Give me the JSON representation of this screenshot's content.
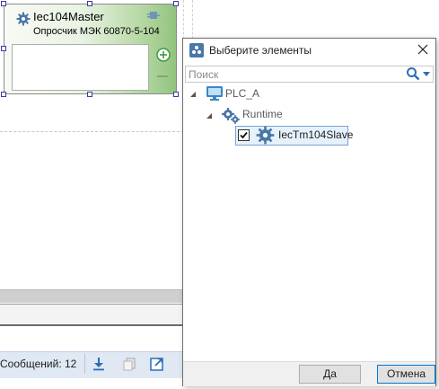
{
  "node": {
    "title": "Iec104Master",
    "subtitle": "Опросчик МЭК 60870-5-104",
    "icon": "gear-icon",
    "accent": "#92c47f"
  },
  "status_bar": {
    "messages_label": "Сообщений: 12"
  },
  "dialog": {
    "title": "Выберите элементы",
    "search": {
      "placeholder": "Поиск",
      "value": ""
    },
    "tree": [
      {
        "label": "PLC_A",
        "icon": "monitor-icon",
        "expanded": true
      },
      {
        "label": "Runtime",
        "icon": "gears-icon",
        "expanded": true
      },
      {
        "label": "IecTm104Slave",
        "icon": "gear-icon",
        "checked": true,
        "selected": true
      }
    ],
    "ok_label": "Да",
    "cancel_label": "Отмена",
    "selection_color": "#e5f1fb"
  }
}
